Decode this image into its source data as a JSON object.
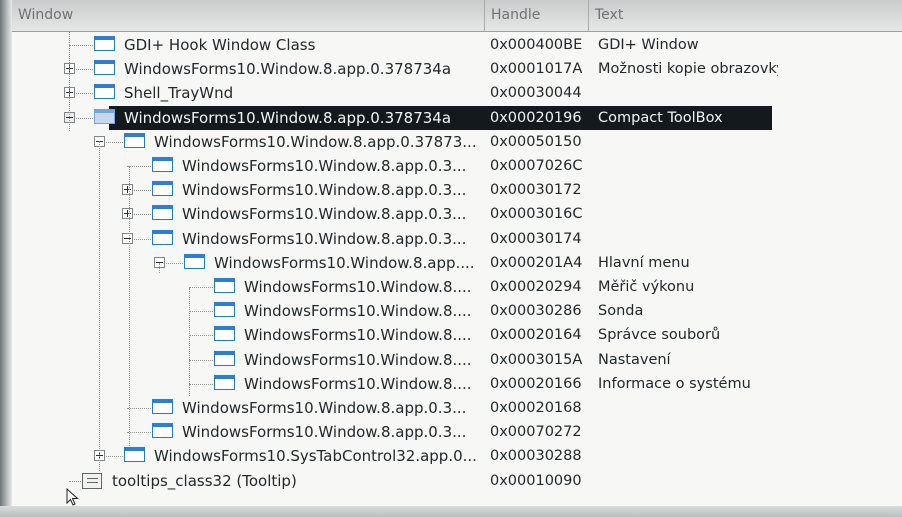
{
  "header": {
    "col_window": "Window",
    "col_handle": "Handle",
    "col_text": "Text"
  },
  "rows": [
    {
      "name": "GDI+ Hook Window Class",
      "handle": "0x000400BE",
      "text": "GDI+ Window",
      "level": 0,
      "expander": "none",
      "icon": "window-icon"
    },
    {
      "name": "WindowsForms10.Window.8.app.0.378734a",
      "handle": "0x0001017A",
      "text": "Možnosti kopie obrazovky",
      "level": 0,
      "expander": "plus",
      "icon": "window-icon"
    },
    {
      "name": "Shell_TrayWnd",
      "handle": "0x00030044",
      "text": "",
      "level": 0,
      "expander": "plus",
      "icon": "window-icon"
    },
    {
      "name": "WindowsForms10.Window.8.app.0.378734a",
      "handle": "0x00020196",
      "text": "Compact ToolBox",
      "level": 0,
      "expander": "minus",
      "icon": "window-icon",
      "selected": true
    },
    {
      "name": "WindowsForms10.Window.8.app.0.37873...",
      "handle": "0x00050150",
      "text": "",
      "level": 1,
      "expander": "minus",
      "icon": "window-icon"
    },
    {
      "name": "WindowsForms10.Window.8.app.0.3...",
      "handle": "0x0007026C",
      "text": "",
      "level": 2,
      "expander": "none",
      "icon": "window-icon"
    },
    {
      "name": "WindowsForms10.Window.8.app.0.3...",
      "handle": "0x00030172",
      "text": "",
      "level": 2,
      "expander": "plus",
      "icon": "window-icon"
    },
    {
      "name": "WindowsForms10.Window.8.app.0.3...",
      "handle": "0x0003016C",
      "text": "",
      "level": 2,
      "expander": "plus",
      "icon": "window-icon"
    },
    {
      "name": "WindowsForms10.Window.8.app.0.3...",
      "handle": "0x00030174",
      "text": "",
      "level": 2,
      "expander": "minus",
      "icon": "window-icon"
    },
    {
      "name": "WindowsForms10.Window.8.app....",
      "handle": "0x000201A4",
      "text": "Hlavní menu",
      "level": 3,
      "expander": "minus",
      "icon": "window-icon"
    },
    {
      "name": "WindowsForms10.Window.8....",
      "handle": "0x00020294",
      "text": "Měřič výkonu",
      "level": 4,
      "expander": "none",
      "icon": "window-icon"
    },
    {
      "name": "WindowsForms10.Window.8....",
      "handle": "0x00030286",
      "text": "Sonda",
      "level": 4,
      "expander": "none",
      "icon": "window-icon"
    },
    {
      "name": "WindowsForms10.Window.8....",
      "handle": "0x00020164",
      "text": "Správce souborů",
      "level": 4,
      "expander": "none",
      "icon": "window-icon"
    },
    {
      "name": "WindowsForms10.Window.8....",
      "handle": "0x0003015A",
      "text": "Nastavení",
      "level": 4,
      "expander": "none",
      "icon": "window-icon"
    },
    {
      "name": "WindowsForms10.Window.8....",
      "handle": "0x00020166",
      "text": "Informace o systému",
      "level": 4,
      "expander": "none",
      "icon": "window-icon"
    },
    {
      "name": "WindowsForms10.Window.8.app.0.3...",
      "handle": "0x00020168",
      "text": "",
      "level": 2,
      "expander": "none",
      "icon": "window-icon"
    },
    {
      "name": "WindowsForms10.Window.8.app.0.3...",
      "handle": "0x00070272",
      "text": "",
      "level": 2,
      "expander": "none",
      "icon": "window-icon"
    },
    {
      "name": "WindowsForms10.SysTabControl32.app.0...",
      "handle": "0x00030288",
      "text": "",
      "level": 1,
      "expander": "plus",
      "icon": "window-icon"
    },
    {
      "name": "tooltips_class32 (Tooltip)",
      "handle": "0x00010090",
      "text": "",
      "level": 0,
      "expander": "none",
      "icon": "tooltip-icon"
    }
  ]
}
